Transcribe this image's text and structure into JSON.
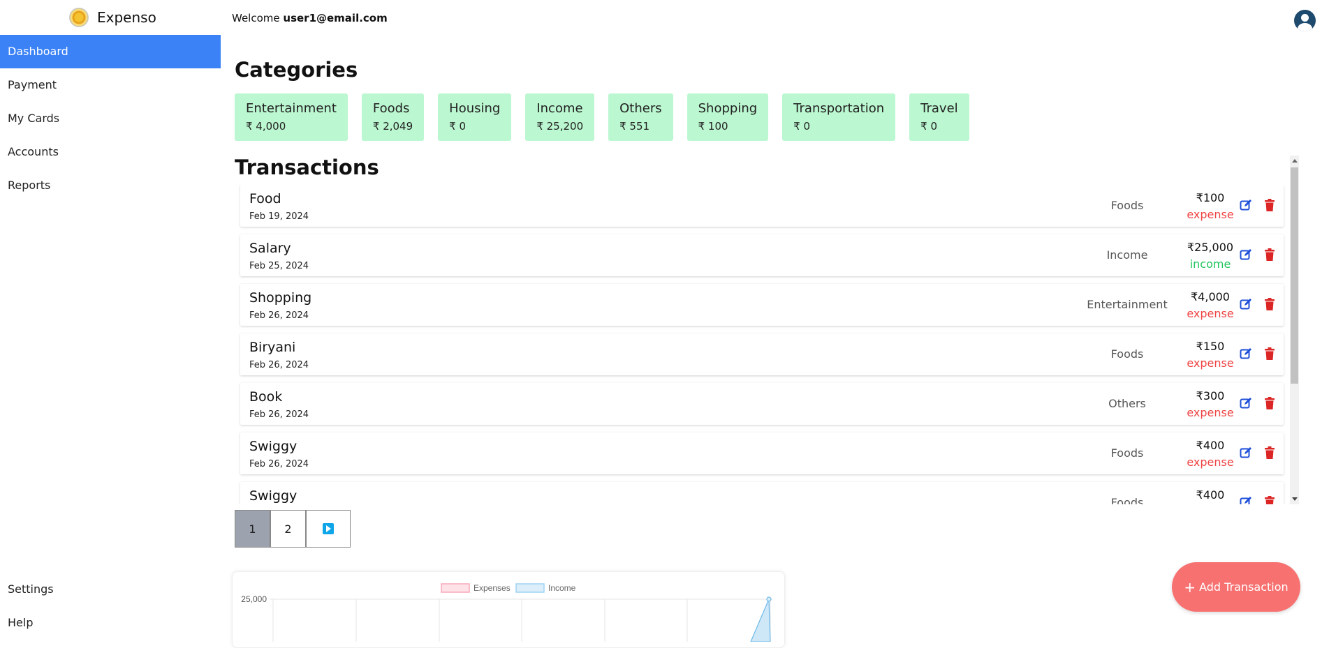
{
  "brand": {
    "name": "Expenso"
  },
  "sidebar": {
    "items": [
      {
        "label": "Dashboard"
      },
      {
        "label": "Payment"
      },
      {
        "label": "My Cards"
      },
      {
        "label": "Accounts"
      },
      {
        "label": "Reports"
      }
    ],
    "bottom_items": [
      {
        "label": "Settings"
      },
      {
        "label": "Help"
      }
    ]
  },
  "header": {
    "welcome_prefix": "Welcome ",
    "user_email": "user1@email.com"
  },
  "categories": {
    "title": "Categories",
    "items": [
      {
        "name": "Entertainment",
        "amount": "₹ 4,000"
      },
      {
        "name": "Foods",
        "amount": "₹ 2,049"
      },
      {
        "name": "Housing",
        "amount": "₹ 0"
      },
      {
        "name": "Income",
        "amount": "₹ 25,200"
      },
      {
        "name": "Others",
        "amount": "₹ 551"
      },
      {
        "name": "Shopping",
        "amount": "₹ 100"
      },
      {
        "name": "Transportation",
        "amount": "₹ 0"
      },
      {
        "name": "Travel",
        "amount": "₹ 0"
      }
    ]
  },
  "transactions": {
    "title": "Transactions",
    "rows": [
      {
        "title": "Food",
        "date": "Feb 19, 2024",
        "category": "Foods",
        "amount": "₹100",
        "type": "expense"
      },
      {
        "title": "Salary",
        "date": "Feb 25, 2024",
        "category": "Income",
        "amount": "₹25,000",
        "type": "income"
      },
      {
        "title": "Shopping",
        "date": "Feb 26, 2024",
        "category": "Entertainment",
        "amount": "₹4,000",
        "type": "expense"
      },
      {
        "title": "Biryani",
        "date": "Feb 26, 2024",
        "category": "Foods",
        "amount": "₹150",
        "type": "expense"
      },
      {
        "title": "Book",
        "date": "Feb 26, 2024",
        "category": "Others",
        "amount": "₹300",
        "type": "expense"
      },
      {
        "title": "Swiggy",
        "date": "Feb 26, 2024",
        "category": "Foods",
        "amount": "₹400",
        "type": "expense"
      },
      {
        "title": "Swiggy",
        "date": "",
        "category": "Foods",
        "amount": "₹400",
        "type": ""
      }
    ]
  },
  "pagination": {
    "pages": [
      "1",
      "2"
    ],
    "current": "1"
  },
  "chart_data": {
    "type": "area",
    "series": [
      {
        "name": "Expenses",
        "color": "#f9a8b8"
      },
      {
        "name": "Income",
        "color": "#9fd3f3"
      }
    ],
    "y_tick_labels": [
      "25,000"
    ],
    "income_last_value": 25000
  },
  "actions": {
    "add_transaction": "Add Transaction"
  },
  "colors": {
    "accent": "#3b82f6",
    "category_bg": "#bbf7d0",
    "add_button": "#f87171",
    "expense": "#ef4444",
    "income": "#22c55e"
  }
}
